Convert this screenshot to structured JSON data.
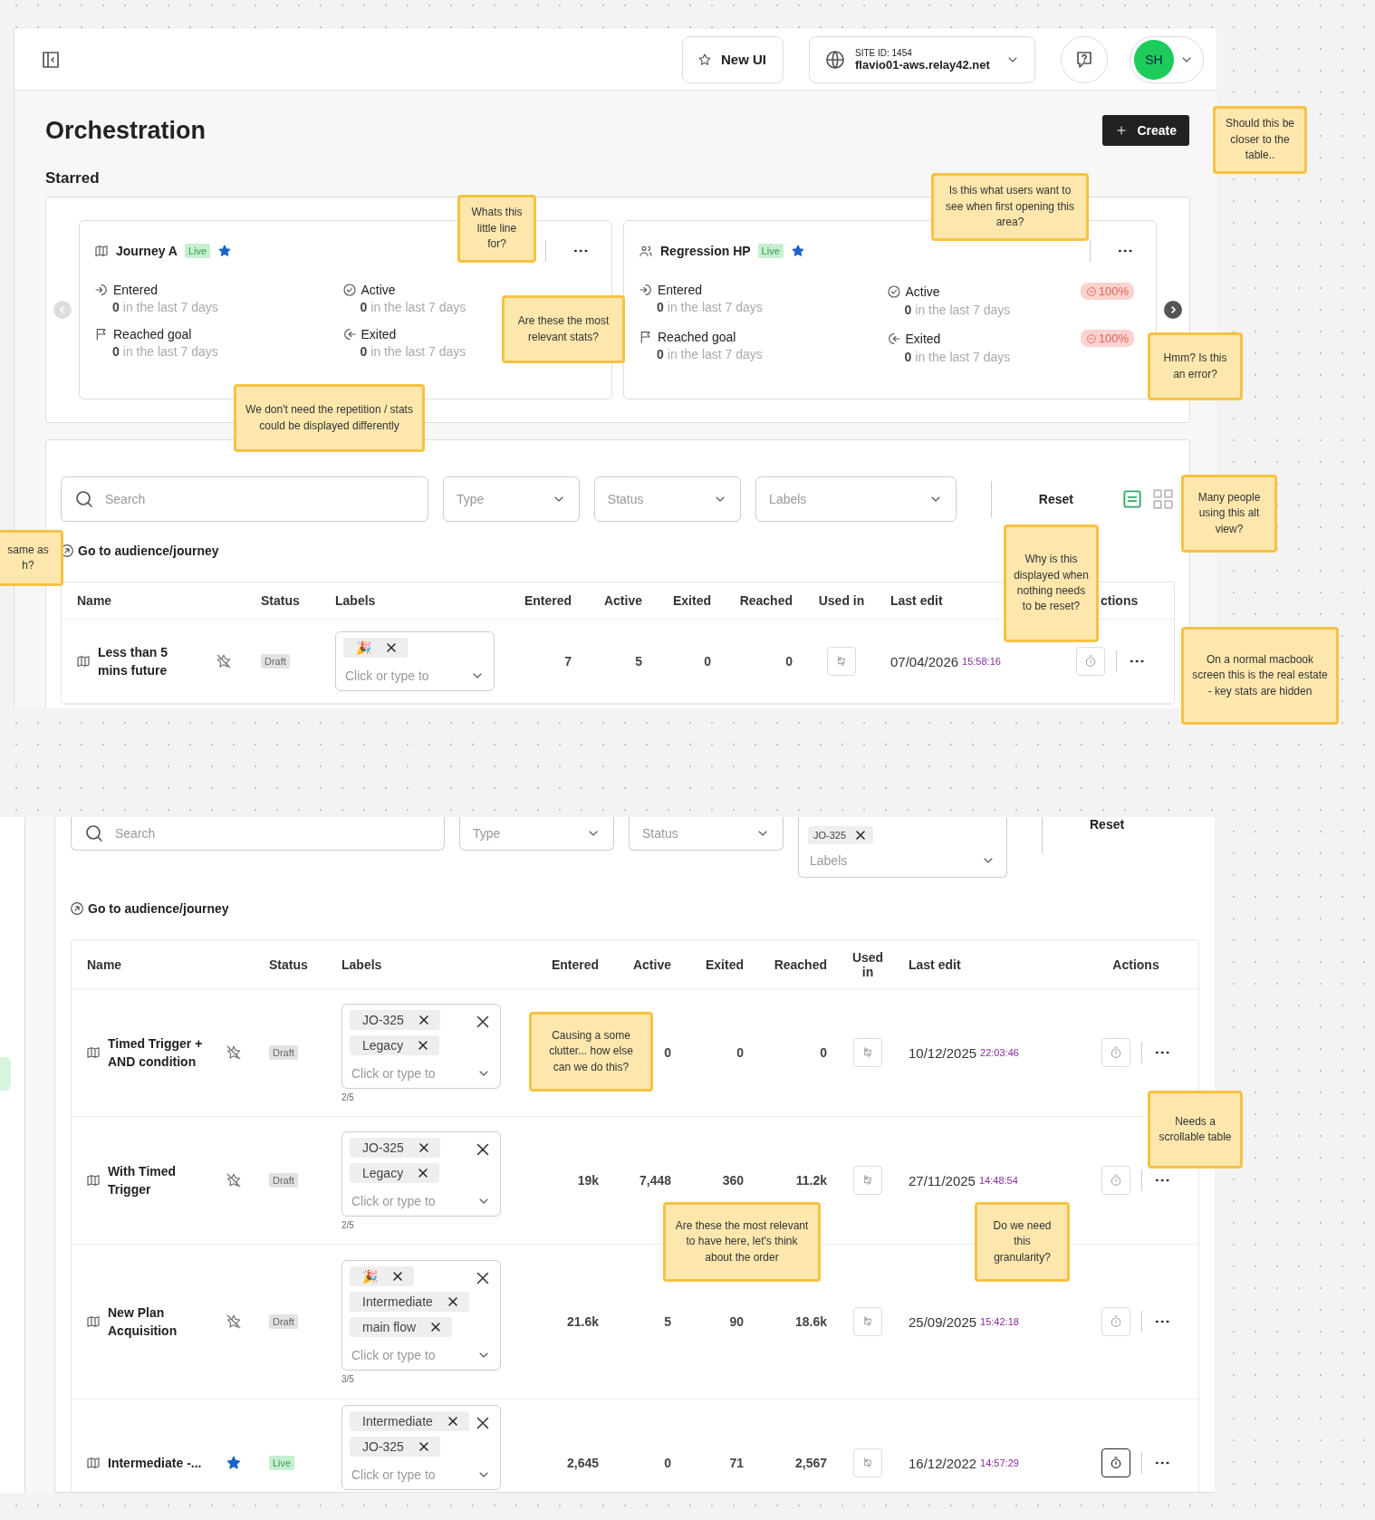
{
  "header": {
    "new_ui": "New UI",
    "site_label": "SITE ID: 1454",
    "site": "flavio01-aws.relay42.net",
    "avatar": "SH"
  },
  "page": {
    "title": "Orchestration",
    "create": "Create",
    "starred_heading": "Starred"
  },
  "carousel": {
    "prev_disabled": true,
    "next_disabled": false
  },
  "starred": [
    {
      "name": "Journey A",
      "kind": "journey",
      "status": "Live",
      "starred": true,
      "stats": [
        {
          "kind": "entered",
          "label": "Entered",
          "value": "0",
          "period": "in the last 7 days"
        },
        {
          "kind": "active",
          "label": "Active",
          "value": "0",
          "period": "in the last 7 days"
        },
        {
          "kind": "reached",
          "label": "Reached goal",
          "value": "0",
          "period": "in the last 7 days"
        },
        {
          "kind": "exited",
          "label": "Exited",
          "value": "0",
          "period": "in the last 7 days"
        }
      ]
    },
    {
      "name": "Regression HP",
      "kind": "audience",
      "status": "Live",
      "starred": true,
      "stats": [
        {
          "kind": "entered",
          "label": "Entered",
          "value": "0",
          "period": "in the last 7 days"
        },
        {
          "kind": "active",
          "label": "Active",
          "value": "0",
          "period": "in the last 7 days",
          "change": "100%"
        },
        {
          "kind": "reached",
          "label": "Reached goal",
          "value": "0",
          "period": "in the last 7 days"
        },
        {
          "kind": "exited",
          "label": "Exited",
          "value": "0",
          "period": "in the last 7 days",
          "change": "100%"
        }
      ]
    }
  ],
  "sections": [
    {
      "filters": {
        "search_placeholder": "Search",
        "type": "Type",
        "status": "Status",
        "labels": "Labels",
        "reset": "Reset",
        "views": [
          {
            "kind": "list",
            "selected": true
          },
          {
            "kind": "grid",
            "selected": false
          }
        ]
      },
      "goto": "Go to audience/journey",
      "table": {
        "columns": [
          "Name",
          "Status",
          "Labels",
          "Entered",
          "Active",
          "Exited",
          "Reached",
          "Used in",
          "Last edit",
          "ctions"
        ],
        "rows": [
          {
            "name": "Less than 5 mins future",
            "starred": false,
            "status": "Draft",
            "live": false,
            "labels": [
              "🎉"
            ],
            "clear_all": false,
            "placeholder": "Click or type to",
            "entered": "7",
            "active": "5",
            "exited": "0",
            "reached": "0",
            "date": "07/04/2026",
            "time": "15:58:16",
            "timer_active": false
          }
        ]
      }
    },
    {
      "filters": {
        "search_placeholder": "Search",
        "type": "Type",
        "status": "Status",
        "label_chips": [
          "JO-325"
        ],
        "labels": "Labels",
        "reset": "Reset"
      },
      "goto": "Go to audience/journey",
      "table": {
        "columns": [
          "Name",
          "Status",
          "Labels",
          "Entered",
          "Active",
          "Exited",
          "Reached",
          "Used in",
          "Last edit",
          "Actions"
        ],
        "rows": [
          {
            "name": "Timed Trigger + AND condition",
            "starred": false,
            "status": "Draft",
            "live": false,
            "labels": [
              "JO-325",
              "Legacy"
            ],
            "clear_all": true,
            "placeholder": "Click or type to",
            "count": "2/5",
            "active": "0",
            "exited": "0",
            "reached": "0",
            "date": "10/12/2025",
            "time": "22:03:46",
            "timer_active": false
          },
          {
            "name": "With Timed Trigger",
            "starred": false,
            "status": "Draft",
            "live": false,
            "labels": [
              "JO-325",
              "Legacy"
            ],
            "clear_all": true,
            "placeholder": "Click or type to",
            "count": "2/5",
            "entered": "19k",
            "active": "7,448",
            "exited": "360",
            "reached": "11.2k",
            "date": "27/11/2025",
            "time": "14:48:54",
            "timer_active": false
          },
          {
            "name": "New Plan Acquisition",
            "starred": false,
            "status": "Draft",
            "live": false,
            "labels": [
              "🎉",
              "Intermediate",
              "main flow"
            ],
            "clear_all": true,
            "placeholder": "Click or type to",
            "count": "3/5",
            "entered": "21.6k",
            "active": "5",
            "exited": "90",
            "reached": "18.6k",
            "date": "25/09/2025",
            "time": "15:42:18",
            "timer_active": false
          },
          {
            "name": "Intermediate -...",
            "starred": true,
            "status": "Live",
            "live": true,
            "labels": [
              "Intermediate",
              "JO-325"
            ],
            "clear_all": true,
            "placeholder": "Click or type to",
            "entered": "2,645",
            "active": "0",
            "exited": "71",
            "reached": "2,567",
            "date": "16/12/2022",
            "time": "14:57:29",
            "timer_active": true
          }
        ]
      }
    }
  ],
  "notes": [
    {
      "text": "Whats this little line for?"
    },
    {
      "text": "Is this what users want to see when first opening this area?"
    },
    {
      "text": "Should this be closer to the table.."
    },
    {
      "text": "Are these the most relevant stats?"
    },
    {
      "text": "Hmm? Is this an error?"
    },
    {
      "text": "We don't need the repetition / stats could be displayed differently"
    },
    {
      "text": "same as h?"
    },
    {
      "text": "Many people using this alt view?"
    },
    {
      "text": "Why is this displayed when nothing needs to be reset?"
    },
    {
      "text": "On a normal macbook screen this is the real estate - key stats are hidden"
    },
    {
      "text": "Causing a some clutter... how else can we do this?"
    },
    {
      "text": "Needs a scrollable table"
    },
    {
      "text": "Are these the most relevant to have here, let's think about the order"
    },
    {
      "text": "Do we need this granularity?"
    }
  ]
}
